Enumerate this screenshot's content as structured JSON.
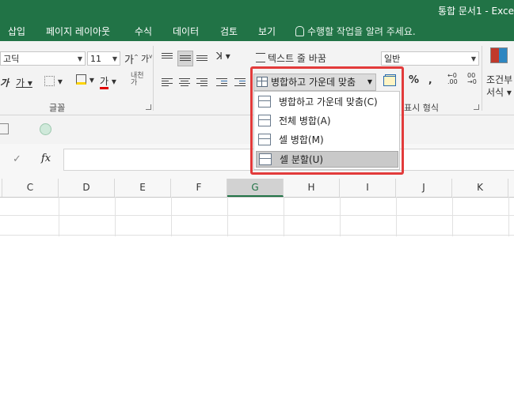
{
  "window": {
    "title": "통합 문서1 - Exce"
  },
  "tabs": [
    {
      "label": "삽입"
    },
    {
      "label": "페이지 레이아웃"
    },
    {
      "label": "수식"
    },
    {
      "label": "데이터"
    },
    {
      "label": "검토"
    },
    {
      "label": "보기"
    }
  ],
  "tellme": {
    "text": "수행할 작업을 알려 주세요."
  },
  "ribbon": {
    "font_name": "고딕",
    "font_size": "11",
    "grow_label": "가",
    "shrink_label": "가",
    "underline_label": "가",
    "font_color_label": "가",
    "font_group_label": "글꼴",
    "wrap_text_label": "텍스트 줄 바꿈",
    "merge_center_label": "병합하고 가운데 맞춤",
    "number_format": "일반",
    "percent_label": "%",
    "decimal_label": "0",
    "number_group_label": "표시 형식",
    "cond_format_label_1": "조건부",
    "cond_format_label_2": "서식"
  },
  "merge_menu": {
    "items": [
      {
        "label": "병합하고 가운데 맞춤(C)"
      },
      {
        "label": "전체 병합(A)"
      },
      {
        "label": "셀 병합(M)"
      },
      {
        "label": "셀 분할(U)"
      }
    ]
  },
  "formula_bar": {
    "fx": "fx",
    "check": "✓"
  },
  "columns": [
    "C",
    "D",
    "E",
    "F",
    "G",
    "H",
    "I",
    "J",
    "K"
  ],
  "selected_column": "G",
  "colors": {
    "accent": "#217346",
    "highlight_box": "#e23b3b"
  }
}
